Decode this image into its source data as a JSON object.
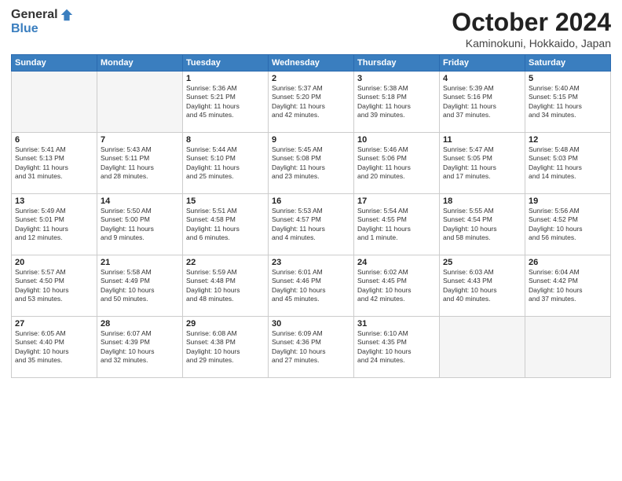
{
  "header": {
    "logo": {
      "general": "General",
      "blue": "Blue"
    },
    "title": "October 2024",
    "location": "Kaminokuni, Hokkaido, Japan"
  },
  "weekdays": [
    "Sunday",
    "Monday",
    "Tuesday",
    "Wednesday",
    "Thursday",
    "Friday",
    "Saturday"
  ],
  "weeks": [
    [
      {
        "day": "",
        "info": ""
      },
      {
        "day": "",
        "info": ""
      },
      {
        "day": "1",
        "info": "Sunrise: 5:36 AM\nSunset: 5:21 PM\nDaylight: 11 hours\nand 45 minutes."
      },
      {
        "day": "2",
        "info": "Sunrise: 5:37 AM\nSunset: 5:20 PM\nDaylight: 11 hours\nand 42 minutes."
      },
      {
        "day": "3",
        "info": "Sunrise: 5:38 AM\nSunset: 5:18 PM\nDaylight: 11 hours\nand 39 minutes."
      },
      {
        "day": "4",
        "info": "Sunrise: 5:39 AM\nSunset: 5:16 PM\nDaylight: 11 hours\nand 37 minutes."
      },
      {
        "day": "5",
        "info": "Sunrise: 5:40 AM\nSunset: 5:15 PM\nDaylight: 11 hours\nand 34 minutes."
      }
    ],
    [
      {
        "day": "6",
        "info": "Sunrise: 5:41 AM\nSunset: 5:13 PM\nDaylight: 11 hours\nand 31 minutes."
      },
      {
        "day": "7",
        "info": "Sunrise: 5:43 AM\nSunset: 5:11 PM\nDaylight: 11 hours\nand 28 minutes."
      },
      {
        "day": "8",
        "info": "Sunrise: 5:44 AM\nSunset: 5:10 PM\nDaylight: 11 hours\nand 25 minutes."
      },
      {
        "day": "9",
        "info": "Sunrise: 5:45 AM\nSunset: 5:08 PM\nDaylight: 11 hours\nand 23 minutes."
      },
      {
        "day": "10",
        "info": "Sunrise: 5:46 AM\nSunset: 5:06 PM\nDaylight: 11 hours\nand 20 minutes."
      },
      {
        "day": "11",
        "info": "Sunrise: 5:47 AM\nSunset: 5:05 PM\nDaylight: 11 hours\nand 17 minutes."
      },
      {
        "day": "12",
        "info": "Sunrise: 5:48 AM\nSunset: 5:03 PM\nDaylight: 11 hours\nand 14 minutes."
      }
    ],
    [
      {
        "day": "13",
        "info": "Sunrise: 5:49 AM\nSunset: 5:01 PM\nDaylight: 11 hours\nand 12 minutes."
      },
      {
        "day": "14",
        "info": "Sunrise: 5:50 AM\nSunset: 5:00 PM\nDaylight: 11 hours\nand 9 minutes."
      },
      {
        "day": "15",
        "info": "Sunrise: 5:51 AM\nSunset: 4:58 PM\nDaylight: 11 hours\nand 6 minutes."
      },
      {
        "day": "16",
        "info": "Sunrise: 5:53 AM\nSunset: 4:57 PM\nDaylight: 11 hours\nand 4 minutes."
      },
      {
        "day": "17",
        "info": "Sunrise: 5:54 AM\nSunset: 4:55 PM\nDaylight: 11 hours\nand 1 minute."
      },
      {
        "day": "18",
        "info": "Sunrise: 5:55 AM\nSunset: 4:54 PM\nDaylight: 10 hours\nand 58 minutes."
      },
      {
        "day": "19",
        "info": "Sunrise: 5:56 AM\nSunset: 4:52 PM\nDaylight: 10 hours\nand 56 minutes."
      }
    ],
    [
      {
        "day": "20",
        "info": "Sunrise: 5:57 AM\nSunset: 4:50 PM\nDaylight: 10 hours\nand 53 minutes."
      },
      {
        "day": "21",
        "info": "Sunrise: 5:58 AM\nSunset: 4:49 PM\nDaylight: 10 hours\nand 50 minutes."
      },
      {
        "day": "22",
        "info": "Sunrise: 5:59 AM\nSunset: 4:48 PM\nDaylight: 10 hours\nand 48 minutes."
      },
      {
        "day": "23",
        "info": "Sunrise: 6:01 AM\nSunset: 4:46 PM\nDaylight: 10 hours\nand 45 minutes."
      },
      {
        "day": "24",
        "info": "Sunrise: 6:02 AM\nSunset: 4:45 PM\nDaylight: 10 hours\nand 42 minutes."
      },
      {
        "day": "25",
        "info": "Sunrise: 6:03 AM\nSunset: 4:43 PM\nDaylight: 10 hours\nand 40 minutes."
      },
      {
        "day": "26",
        "info": "Sunrise: 6:04 AM\nSunset: 4:42 PM\nDaylight: 10 hours\nand 37 minutes."
      }
    ],
    [
      {
        "day": "27",
        "info": "Sunrise: 6:05 AM\nSunset: 4:40 PM\nDaylight: 10 hours\nand 35 minutes."
      },
      {
        "day": "28",
        "info": "Sunrise: 6:07 AM\nSunset: 4:39 PM\nDaylight: 10 hours\nand 32 minutes."
      },
      {
        "day": "29",
        "info": "Sunrise: 6:08 AM\nSunset: 4:38 PM\nDaylight: 10 hours\nand 29 minutes."
      },
      {
        "day": "30",
        "info": "Sunrise: 6:09 AM\nSunset: 4:36 PM\nDaylight: 10 hours\nand 27 minutes."
      },
      {
        "day": "31",
        "info": "Sunrise: 6:10 AM\nSunset: 4:35 PM\nDaylight: 10 hours\nand 24 minutes."
      },
      {
        "day": "",
        "info": ""
      },
      {
        "day": "",
        "info": ""
      }
    ]
  ]
}
